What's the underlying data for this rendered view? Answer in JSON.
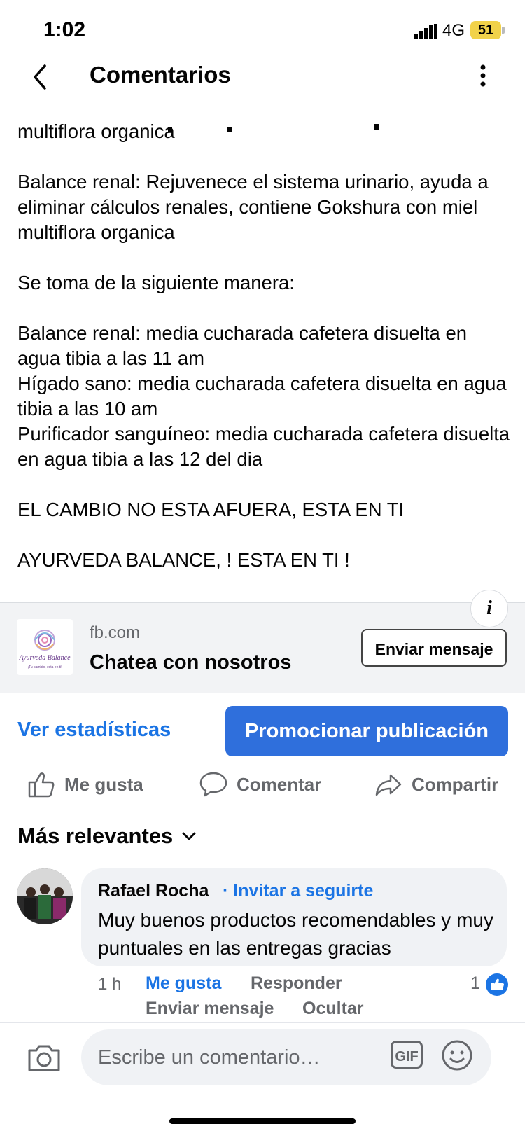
{
  "status_bar": {
    "time": "1:02",
    "network": "4G",
    "battery": "51"
  },
  "header": {
    "title": "Comentarios"
  },
  "post": {
    "text": "multiflora organica\n\nBalance renal: Rejuvenece el sistema urinario, ayuda a eliminar cálculos renales, contiene Gokshura con miel multiflora organica\n\nSe toma de la siguiente manera:\n\nBalance renal: media cucharada cafetera disuelta en agua tibia a las 11 am\nHígado sano: media cucharada cafetera disuelta en agua tibia a las 10 am\nPurificador sanguíneo: media cucharada cafetera disuelta en agua tibia a las 12 del dia\n\nEL CAMBIO NO ESTA AFUERA, ESTA EN TI\n\nAYURVEDA BALANCE, ! ESTA EN TI !"
  },
  "ad": {
    "logo_text": "Ayurveda Balance",
    "logo_tagline": "¡Tu cambio, esta en ti!",
    "domain": "fb.com",
    "title": "Chatea con nosotros",
    "button": "Enviar mensaje",
    "info_icon": "i"
  },
  "actions": {
    "stats": "Ver estadísticas",
    "promote": "Promocionar publicación",
    "like": "Me gusta",
    "comment": "Comentar",
    "share": "Compartir"
  },
  "filter": {
    "label": "Más relevantes"
  },
  "comment": {
    "author": "Rafael Rocha",
    "invite": "· Invitar a seguirte",
    "text": "Muy buenos productos recomendables y muy puntuales en las entregas gracias",
    "time": "1 h",
    "like": "Me gusta",
    "reply": "Responder",
    "reactions": "1",
    "send_message": "Enviar mensaje",
    "hide": "Ocultar"
  },
  "composer": {
    "placeholder": "Escribe un comentario…"
  },
  "colors": {
    "accent": "#1b74e4",
    "button_blue": "#2f6fdc",
    "muted": "#65676b"
  }
}
